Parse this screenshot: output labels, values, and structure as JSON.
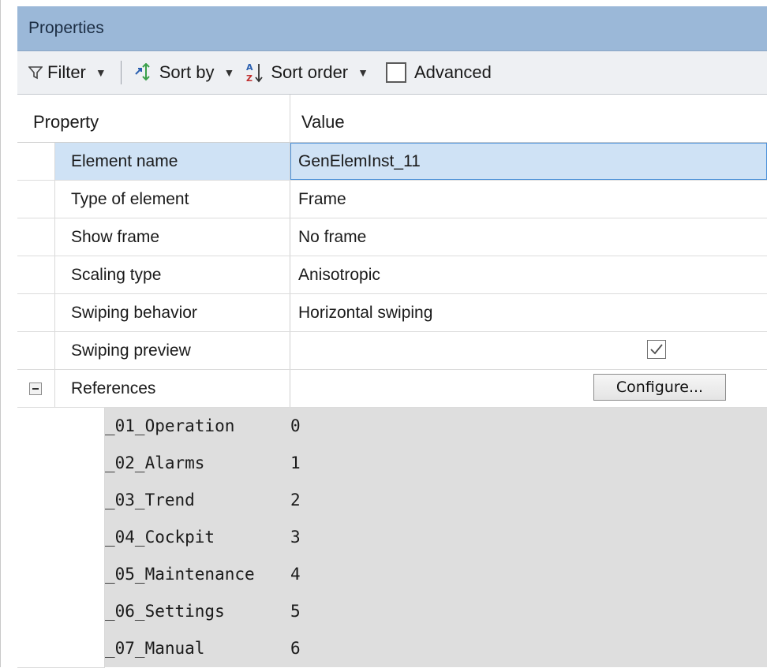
{
  "title": "Properties",
  "toolbar": {
    "filter": "Filter",
    "sort_by": "Sort by",
    "sort_order": "Sort order",
    "advanced": "Advanced"
  },
  "columns": {
    "property": "Property",
    "value": "Value"
  },
  "rows": [
    {
      "name": "Element name",
      "value": "GenElemInst_11"
    },
    {
      "name": "Type of element",
      "value": "Frame"
    },
    {
      "name": "Show frame",
      "value": "No frame"
    },
    {
      "name": "Scaling type",
      "value": "Anisotropic"
    },
    {
      "name": "Swiping behavior",
      "value": "Horizontal swiping"
    },
    {
      "name": "Swiping preview",
      "value": ""
    }
  ],
  "references": {
    "label": "References",
    "button": "Configure...",
    "items": [
      {
        "name": "_01_Operation",
        "value": "0"
      },
      {
        "name": "_02_Alarms",
        "value": "1"
      },
      {
        "name": "_03_Trend",
        "value": "2"
      },
      {
        "name": "_04_Cockpit",
        "value": "3"
      },
      {
        "name": "_05_Maintenance",
        "value": "4"
      },
      {
        "name": "_06_Settings",
        "value": "5"
      },
      {
        "name": "_07_Manual",
        "value": "6"
      }
    ]
  },
  "swiping_preview_checked": true,
  "colors": {
    "titlebar": "#9bb8d8",
    "selection": "#cfe2f5",
    "selection_border": "#4a90d9",
    "reference_bg": "#dedede"
  },
  "icons": {
    "filter": "funnel-icon",
    "sort_by": "sort-by-icon",
    "sort_order": "sort-az-icon",
    "expander": "collapse-minus-icon",
    "check": "checkmark-icon"
  }
}
